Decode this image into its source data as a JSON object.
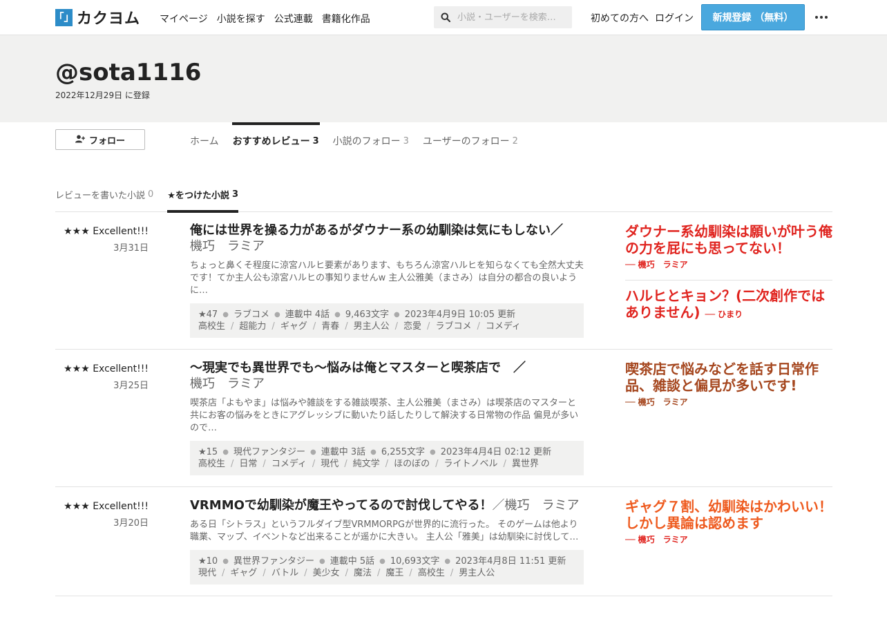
{
  "logo": {
    "mark": "「」",
    "text": "カクヨム"
  },
  "nav": [
    "マイページ",
    "小説を探す",
    "公式連載",
    "書籍化作品"
  ],
  "search": {
    "placeholder": "小説・ユーザーを検索…"
  },
  "header_links": {
    "intro": "初めての方へ",
    "login": "ログイン",
    "signup": "新規登録 （無料）"
  },
  "profile": {
    "name": "@sota1116",
    "registered": "2022年12月29日 に登録"
  },
  "follow_label": "フォロー",
  "tabs": [
    {
      "label": "ホーム",
      "count": ""
    },
    {
      "label": "おすすめレビュー",
      "count": "3"
    },
    {
      "label": "小説のフォロー",
      "count": "3"
    },
    {
      "label": "ユーザーのフォロー",
      "count": "2"
    }
  ],
  "subtabs": [
    {
      "label": "レビューを書いた小説",
      "count": "0"
    },
    {
      "label": "★をつけた小説",
      "count": "3"
    }
  ],
  "colors": {
    "accent_blue": "#4aa8de",
    "review_red": "#e0241f",
    "review_brown": "#a5461e",
    "review_orange": "#ee5a1e"
  },
  "items": [
    {
      "stars": "★★★ Excellent!!!",
      "date": "3月31日",
      "title": "俺には世界を操る力があるがダウナー系の幼馴染は気にもしない／",
      "author": "機巧　ラミア",
      "desc": "ちょっと鼻くそ程度に涼宮ハルヒ要素があります、もちろん涼宮ハルヒを知らなくても全然大丈夫です！てか主人公も涼宮ハルヒの事知りませんw 主人公雅美（まさみ）は自分の都合の良いように…",
      "meta": [
        "★47",
        "ラブコメ",
        "連載中 4話",
        "9,463文字",
        "2023年4月9日 10:05 更新"
      ],
      "tags": [
        "高校生",
        "超能力",
        "ギャグ",
        "青春",
        "男主人公",
        "恋愛",
        "ラブコメ",
        "コメディ"
      ],
      "reviews": [
        {
          "title": "ダウナー系幼馴染は願いが叶う俺の力を屁にも思ってない！",
          "by": "── 機巧　ラミア"
        },
        {
          "title": "ハルヒとキョン？(二次創作ではありません)",
          "by": "── ひまり"
        }
      ]
    },
    {
      "stars": "★★★ Excellent!!!",
      "date": "3月25日",
      "title": "～現実でも異世界でも～悩みは俺とマスターと喫茶店で　／",
      "author": "機巧　ラミア",
      "desc": "喫茶店「よもやま」は悩みや雑談をする雑談喫茶、主人公雅美（まさみ）は喫茶店のマスターと共にお客の悩みをときにアグレッシブに動いたり話したりして解決する日常物の作品 偏見が多いので…",
      "meta": [
        "★15",
        "現代ファンタジー",
        "連載中 3話",
        "6,255文字",
        "2023年4月4日 02:12 更新"
      ],
      "tags": [
        "高校生",
        "日常",
        "コメディ",
        "現代",
        "純文学",
        "ほのぼの",
        "ライトノベル",
        "異世界"
      ],
      "reviews": [
        {
          "title": "喫茶店で悩みなどを話す日常作品、雑談と偏見が多いです!",
          "by": "── 機巧　ラミア"
        }
      ]
    },
    {
      "stars": "★★★ Excellent!!!",
      "date": "3月20日",
      "title": "VRMMOで幼馴染が魔王やってるので討伐してやる！",
      "author": "／機巧　ラミア",
      "desc": "ある日「シトラス」というフルダイブ型VRMMORPGが世界的に流行った。 そのゲームは他より職業、マップ、イベントなど出来ることが遥かに大きい。 主人公「雅美」は幼馴染に討伐して…",
      "meta": [
        "★10",
        "異世界ファンタジー",
        "連載中 5話",
        "10,693文字",
        "2023年4月8日 11:51 更新"
      ],
      "tags": [
        "現代",
        "ギャグ",
        "バトル",
        "美少女",
        "魔法",
        "魔王",
        "高校生",
        "男主人公"
      ],
      "reviews": [
        {
          "title": "ギャグ７割、幼馴染はかわいい！しかし異論は認めます",
          "by": "── 機巧　ラミア"
        }
      ]
    }
  ]
}
